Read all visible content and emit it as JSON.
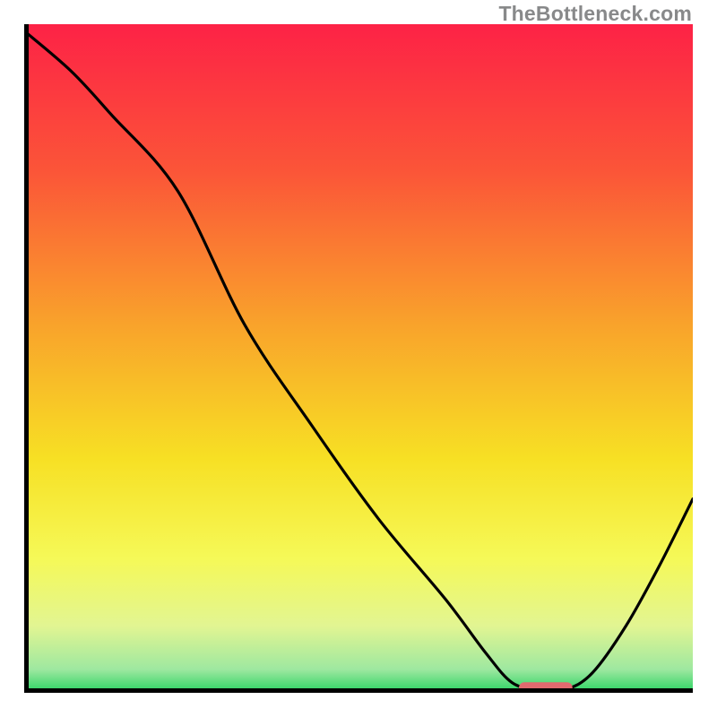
{
  "watermark": "TheBottleneck.com",
  "chart_data": {
    "type": "line",
    "title": "",
    "xlabel": "",
    "ylabel": "",
    "xlim": [
      0,
      100
    ],
    "ylim": [
      0,
      100
    ],
    "grid": false,
    "legend": false,
    "series": [
      {
        "name": "bottleneck-curve",
        "x": [
          0,
          7,
          13,
          23,
          33,
          43,
          53,
          63,
          69,
          73,
          77,
          81,
          85,
          90,
          95,
          100
        ],
        "y": [
          99,
          93,
          86.5,
          75,
          55,
          40,
          26,
          14,
          6,
          1.5,
          0.5,
          0.5,
          3,
          10,
          19,
          29
        ]
      }
    ],
    "marker": {
      "name": "optimal-region",
      "x_start": 74,
      "x_end": 82,
      "y": 0.7,
      "color": "#e26a6f"
    },
    "gradient_stops": [
      {
        "offset": 0,
        "color": "#fd2246"
      },
      {
        "offset": 22,
        "color": "#fb5538"
      },
      {
        "offset": 45,
        "color": "#f9a32b"
      },
      {
        "offset": 65,
        "color": "#f7e024"
      },
      {
        "offset": 80,
        "color": "#f5f958"
      },
      {
        "offset": 90,
        "color": "#e2f592"
      },
      {
        "offset": 96.5,
        "color": "#9ee8a0"
      },
      {
        "offset": 100,
        "color": "#28d261"
      }
    ]
  }
}
